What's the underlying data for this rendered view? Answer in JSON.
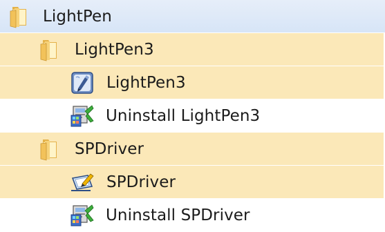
{
  "tree": {
    "root": {
      "label": "LightPen",
      "icon": "folder-icon"
    },
    "items": [
      {
        "label": "LightPen3",
        "icon": "folder-icon"
      },
      {
        "label": "LightPen3",
        "icon": "lightpen-app-icon"
      },
      {
        "label": "Uninstall LightPen3",
        "icon": "uninstall-icon"
      },
      {
        "label": "SPDriver",
        "icon": "folder-icon"
      },
      {
        "label": "SPDriver",
        "icon": "spdriver-app-icon"
      },
      {
        "label": "Uninstall SPDriver",
        "icon": "uninstall-icon"
      }
    ]
  },
  "colors": {
    "root_highlight": "#dbe7f7",
    "folder_highlight": "#fbe8b8",
    "text": "#1b1b1b"
  }
}
